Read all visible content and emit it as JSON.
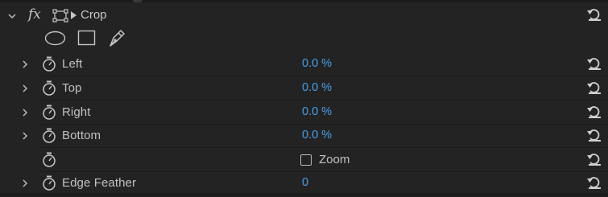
{
  "effect": {
    "fx_label": "fx",
    "title": "Crop",
    "icons": [
      "fx-icon",
      "crop-transform-icon",
      "reset-icon"
    ],
    "mask_tools": [
      {
        "name": "ellipse-mask-tool",
        "icon": "ellipse-icon"
      },
      {
        "name": "rectangle-mask-tool",
        "icon": "rectangle-icon"
      },
      {
        "name": "pen-mask-tool",
        "icon": "pen-icon"
      }
    ]
  },
  "properties": [
    {
      "label": "Left",
      "value": "0.0 %",
      "expandable": true
    },
    {
      "label": "Top",
      "value": "0.0 %",
      "expandable": true
    },
    {
      "label": "Right",
      "value": "0.0 %",
      "expandable": true
    },
    {
      "label": "Bottom",
      "value": "0.0 %",
      "expandable": true
    },
    {
      "label": "",
      "checkbox_label": "Zoom",
      "checked": false,
      "expandable": false
    },
    {
      "label": "Edge Feather",
      "value": "0",
      "expandable": true
    }
  ],
  "colors": {
    "background": "#232323",
    "value_blue": "#4aa0ea",
    "text": "#c2c2c2"
  }
}
